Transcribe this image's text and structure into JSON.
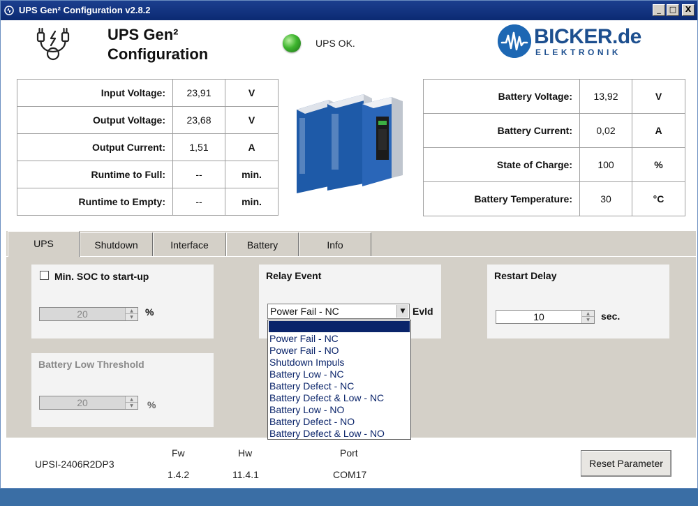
{
  "window": {
    "title": "UPS Gen² Configuration v2.8.2",
    "minimize": "_",
    "maximize": "□",
    "close": "X"
  },
  "header": {
    "title_line1": "UPS Gen²",
    "title_line2": "Configuration",
    "status_text": "UPS OK.",
    "status_color": "#3eb52e",
    "brand_name": "BICKER.de",
    "brand_sub": "ELEKTRONIK",
    "brand_color": "#1d67b3"
  },
  "left_readings": [
    {
      "label": "Input Voltage:",
      "value": "23,91",
      "unit": "V"
    },
    {
      "label": "Output Voltage:",
      "value": "23,68",
      "unit": "V"
    },
    {
      "label": "Output Current:",
      "value": "1,51",
      "unit": "A"
    },
    {
      "label": "Runtime to Full:",
      "value": "--",
      "unit": "min."
    },
    {
      "label": "Runtime to Empty:",
      "value": "--",
      "unit": "min."
    }
  ],
  "right_readings": [
    {
      "label": "Battery Voltage:",
      "value": "13,92",
      "unit": "V"
    },
    {
      "label": "Battery Current:",
      "value": "0,02",
      "unit": "A"
    },
    {
      "label": "State of Charge:",
      "value": "100",
      "unit": "%"
    },
    {
      "label": "Battery Temperature:",
      "value": "30",
      "unit": "°C"
    }
  ],
  "tabs": [
    {
      "label": "UPS",
      "active": true
    },
    {
      "label": "Shutdown"
    },
    {
      "label": "Interface"
    },
    {
      "label": "Battery"
    },
    {
      "label": "Info"
    }
  ],
  "ups_tab": {
    "min_soc": {
      "label": "Min. SOC to start-up",
      "checked": false,
      "value": "20",
      "unit": "%"
    },
    "battery_low": {
      "title": "Battery Low Threshold",
      "value": "20",
      "unit": "%"
    },
    "relay_event": {
      "title": "Relay Event",
      "selected": "Power Fail - NC",
      "suffix": "Evld",
      "options": [
        "",
        "Power Fail - NC",
        "Power Fail - NO",
        "Shutdown Impuls",
        "Battery Low - NC",
        "Battery Defect - NC",
        "Battery Defect & Low - NC",
        "Battery Low - NO",
        "Battery Defect - NO",
        "Battery Defect & Low - NO"
      ]
    },
    "restart_delay": {
      "title": "Restart Delay",
      "value": "10",
      "unit": "sec."
    }
  },
  "footer": {
    "model": "UPSI-2406R2DP3",
    "fw_label": "Fw",
    "fw_value": "1.4.2",
    "hw_label": "Hw",
    "hw_value": "11.4.1",
    "port_label": "Port",
    "port_value": "COM17",
    "reset_label": "Reset Parameter"
  }
}
